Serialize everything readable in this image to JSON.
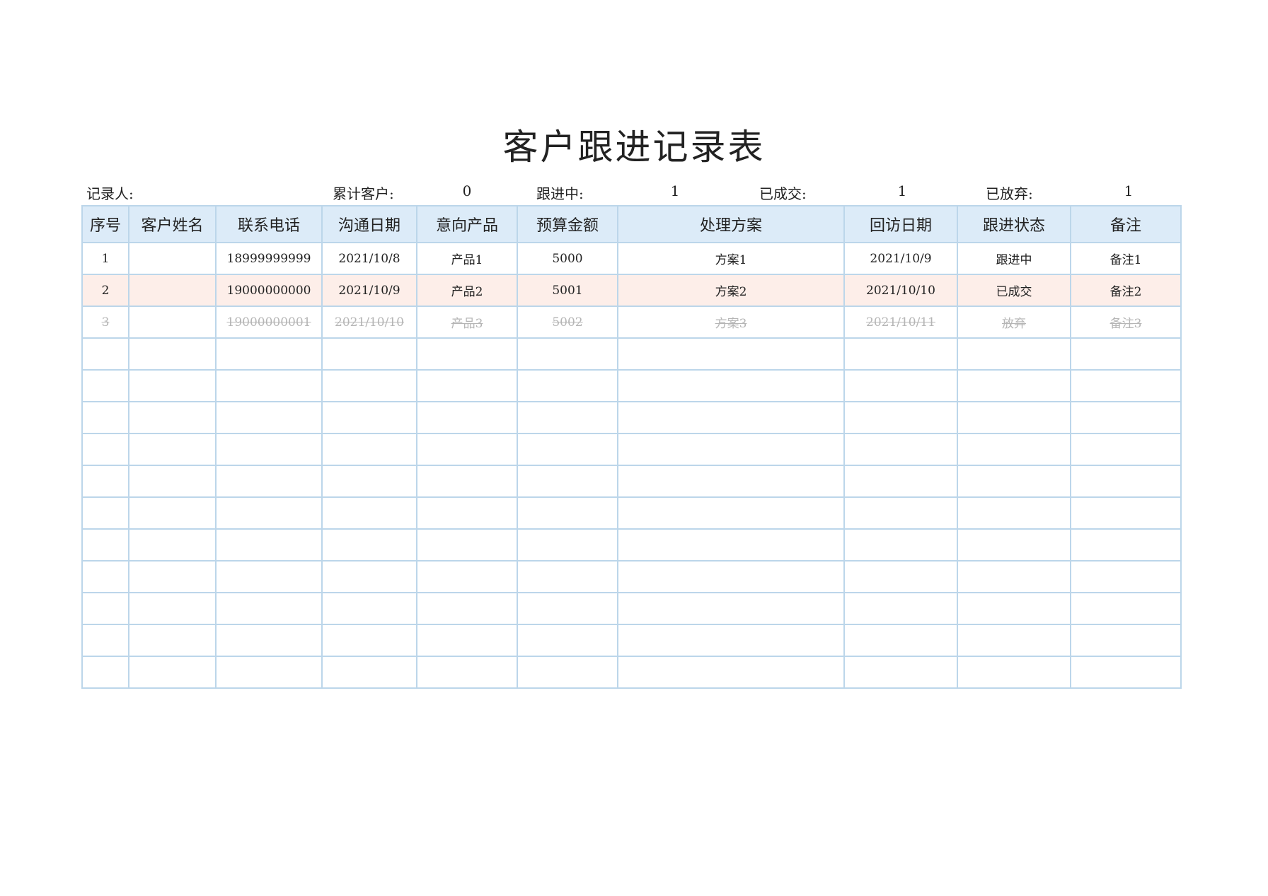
{
  "title": "客户跟进记录表",
  "summary": {
    "recorder_label": "记录人:",
    "total_label": "累计客户:",
    "total_value": "0",
    "following_label": "跟进中:",
    "following_value": "1",
    "closed_label": "已成交:",
    "closed_value": "1",
    "abandoned_label": "已放弃:",
    "abandoned_value": "1"
  },
  "table": {
    "headers": [
      "序号",
      "客户姓名",
      "联系电话",
      "沟通日期",
      "意向产品",
      "预算金额",
      "处理方案",
      "回访日期",
      "跟进状态",
      "备注"
    ],
    "rows": [
      {
        "cells": [
          "1",
          "",
          "18999999999",
          "2021/10/8",
          "产品1",
          "5000",
          "方案1",
          "2021/10/9",
          "跟进中",
          "备注1"
        ]
      },
      {
        "cells": [
          "2",
          "",
          "19000000000",
          "2021/10/9",
          "产品2",
          "5001",
          "方案2",
          "2021/10/10",
          "已成交",
          "备注2"
        ]
      },
      {
        "cells": [
          "3",
          "",
          "19000000001",
          "2021/10/10",
          "产品3",
          "5002",
          "方案3",
          "2021/10/11",
          "放弃",
          "备注3"
        ]
      }
    ]
  },
  "colors": {
    "header_bg": "#dcebf8",
    "border": "#bcd6ea",
    "highlight_row_bg": "#fdeee9",
    "abandoned_text": "#b5b5b5"
  }
}
